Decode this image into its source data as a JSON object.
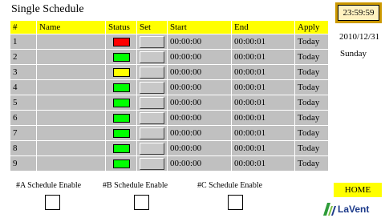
{
  "title": "Single Schedule",
  "clock": {
    "time": "23:59:59"
  },
  "date": "2010/12/31",
  "weekday": "Sunday",
  "table": {
    "headers": [
      "#",
      "Name",
      "Status",
      "Set",
      "Start",
      "End",
      "Apply"
    ],
    "rows": [
      {
        "num": "1",
        "name": "",
        "status_color": "#ff0000",
        "start": "00:00:00",
        "end": "00:00:01",
        "apply": "Today"
      },
      {
        "num": "2",
        "name": "",
        "status_color": "#00ff00",
        "start": "00:00:00",
        "end": "00:00:01",
        "apply": "Today"
      },
      {
        "num": "3",
        "name": "",
        "status_color": "#ffff00",
        "start": "00:00:00",
        "end": "00:00:01",
        "apply": "Today"
      },
      {
        "num": "4",
        "name": "",
        "status_color": "#00ff00",
        "start": "00:00:00",
        "end": "00:00:01",
        "apply": "Today"
      },
      {
        "num": "5",
        "name": "",
        "status_color": "#00ff00",
        "start": "00:00:00",
        "end": "00:00:01",
        "apply": "Today"
      },
      {
        "num": "6",
        "name": "",
        "status_color": "#00ff00",
        "start": "00:00:00",
        "end": "00:00:01",
        "apply": "Today"
      },
      {
        "num": "7",
        "name": "",
        "status_color": "#00ff00",
        "start": "00:00:00",
        "end": "00:00:01",
        "apply": "Today"
      },
      {
        "num": "8",
        "name": "",
        "status_color": "#00ff00",
        "start": "00:00:00",
        "end": "00:00:01",
        "apply": "Today"
      },
      {
        "num": "9",
        "name": "",
        "status_color": "#00ff00",
        "start": "00:00:00",
        "end": "00:00:01",
        "apply": "Today"
      }
    ]
  },
  "enables": [
    {
      "label": "#A Schedule Enable",
      "checked": false
    },
    {
      "label": "#B Schedule Enable",
      "checked": false
    },
    {
      "label": "#C Schedule Enable",
      "checked": false
    }
  ],
  "home_label": "HOME",
  "logo": {
    "text": "LaVent",
    "icon": "lavent-logo-icon"
  },
  "colors": {
    "header_bg": "#ffff00",
    "row_bg": "#c0c0c0",
    "clock_frame": "#cc9900",
    "home_bg": "#ffff00",
    "status_red": "#ff0000",
    "status_green": "#00ff00",
    "status_yellow": "#ffff00"
  }
}
